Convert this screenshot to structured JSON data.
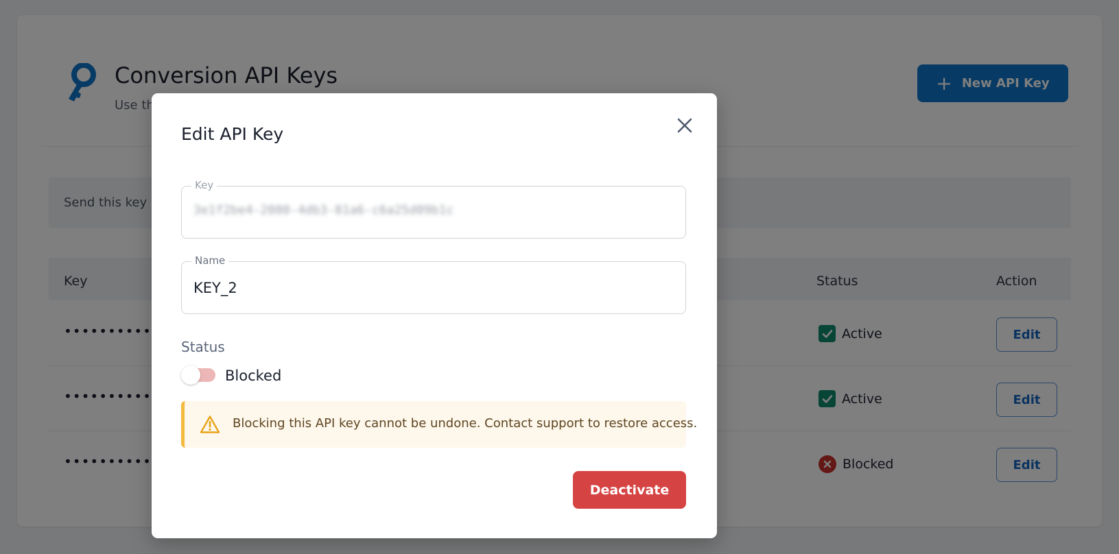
{
  "page": {
    "title": "Conversion API Keys",
    "subtitle": "Use th",
    "new_key_label": "New API Key",
    "info_text": "Send this key ir",
    "columns": {
      "key": "Key",
      "status": "Status",
      "action": "Action"
    },
    "rows": [
      {
        "key": "••••••••••••••",
        "status": "Active",
        "action": "Edit"
      },
      {
        "key": "••••••••••••••",
        "status": "Active",
        "action": "Edit"
      },
      {
        "key": "••••••••••••••",
        "status": "Blocked",
        "action": "Edit"
      }
    ]
  },
  "modal": {
    "title": "Edit API Key",
    "key_label": "Key",
    "key_value": "3e1f2be4-2080-4db3-81a6-c6a25d09b1c",
    "name_label": "Name",
    "name_value": "KEY_2",
    "status_label": "Status",
    "toggle_text": "Blocked",
    "warning_text": "Blocking this API key cannot be undone. Contact support to restore access.",
    "deactivate_label": "Deactivate"
  },
  "colors": {
    "primary": "#0e74c9",
    "danger": "#d64343",
    "success": "#0f8a6c",
    "warning": "#f5b940"
  },
  "icons": {
    "header": "key-icon",
    "close": "close-icon",
    "warning": "warning-triangle-icon",
    "active": "check-square-icon",
    "blocked": "x-circle-icon"
  }
}
